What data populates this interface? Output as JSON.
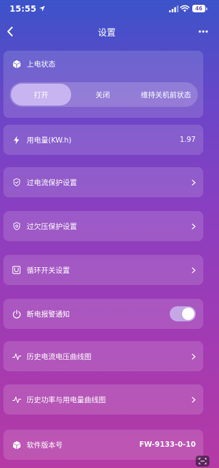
{
  "status_bar": {
    "time": "15:55",
    "battery": "46"
  },
  "nav": {
    "title": "设置"
  },
  "power_state": {
    "label": "上电状态",
    "options": [
      "打开",
      "关闭",
      "维持关机前状态"
    ],
    "selected": "打开"
  },
  "energy": {
    "label": "用电量(KW.h)",
    "value": "1.97"
  },
  "menu": {
    "overcurrent": "过电流保护设置",
    "voltage": "过欠压保护设置",
    "cycle_switch": "循环开关设置",
    "power_off_alert": "断电报警通知",
    "history_current_voltage": "历史电流电压曲线图",
    "history_power_energy": "历史功率与用电量曲线图"
  },
  "power_off_alert_enabled": true,
  "firmware": {
    "label": "软件版本号",
    "value": "FW-9133-0-10"
  },
  "icons": {
    "location": "location-arrow-icon",
    "signal": "signal-icon",
    "wifi": "wifi-icon",
    "back": "chevron-left-icon",
    "more": "more-dots-icon",
    "cube": "cube-icon",
    "bolt": "lightning-icon",
    "shield": "shield-icon",
    "cycle": "cycle-switch-icon",
    "power": "power-icon",
    "chart": "line-chart-icon",
    "chevron": "chevron-right-icon"
  },
  "colors": {
    "toggle_on": "#c5a7e6",
    "segment_active": "#c8b4f0"
  }
}
